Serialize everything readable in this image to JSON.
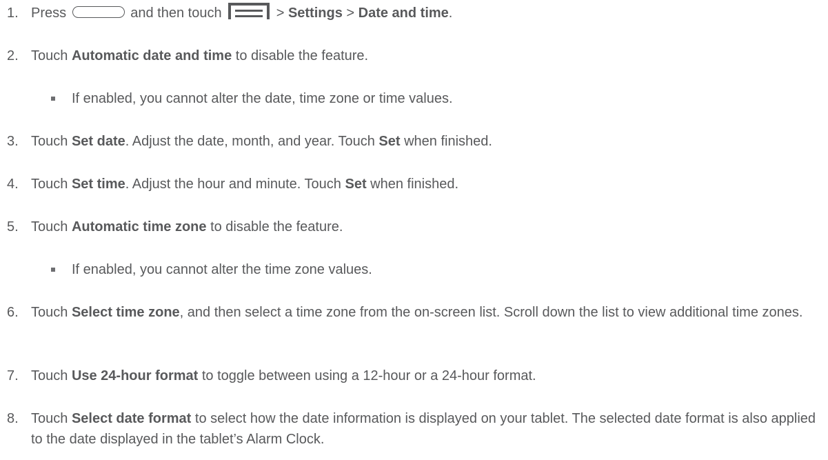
{
  "steps": [
    {
      "num": "1.",
      "parts": [
        "Press ",
        " and then touch ",
        " > ",
        "Settings",
        " > ",
        "Date and time",
        "."
      ]
    },
    {
      "num": "2.",
      "parts": [
        "Touch ",
        "Automatic date and time",
        " to disable the feature."
      ]
    },
    {
      "bullet": "If enabled, you cannot alter the date, time zone or time values."
    },
    {
      "num": "3.",
      "parts": [
        "Touch ",
        "Set date",
        ". Adjust the date, month, and year. Touch ",
        "Set",
        " when finished."
      ]
    },
    {
      "num": "4.",
      "parts": [
        "Touch ",
        "Set time",
        ". Adjust the hour and minute. Touch ",
        "Set",
        " when finished."
      ]
    },
    {
      "num": "5.",
      "parts": [
        "Touch ",
        "Automatic time zone",
        " to disable the feature."
      ]
    },
    {
      "bullet": "If enabled, you cannot alter the time zone values."
    },
    {
      "num": "6.",
      "parts": [
        "Touch ",
        "Select time zone",
        ", and then select a time zone from the on-screen list. Scroll down the list to view additional time zones."
      ]
    },
    {
      "num": "7.",
      "parts": [
        "Touch ",
        "Use 24-hour format",
        " to toggle between using a 12-hour or a 24-hour format."
      ]
    },
    {
      "num": "8.",
      "parts": [
        "Touch ",
        "Select date format",
        " to select how the date information is displayed on your tablet. The selected date format is also applied to the date displayed in the tablet’s Alarm Clock."
      ]
    }
  ],
  "icons": {
    "home": "home-key-icon",
    "menu": "menu-key-icon"
  },
  "colors": {
    "text": "#58595b",
    "icon": "#58595b"
  }
}
